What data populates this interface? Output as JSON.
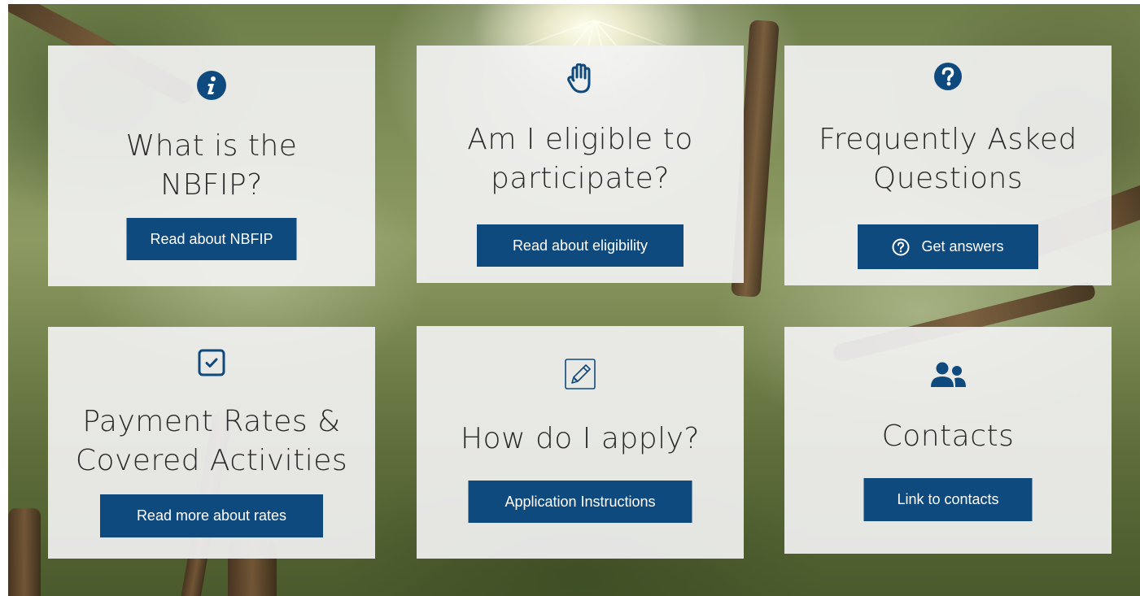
{
  "colors": {
    "accent": "#0f4a7e",
    "card_background": "#f2f2f2",
    "title_text": "#2a2a2a",
    "button_text": "#ffffff"
  },
  "cards": [
    {
      "icon": "info-circle-icon",
      "title_line1": "What is the",
      "title_line2": "NBFIP?",
      "button_label": "Read about NBFIP"
    },
    {
      "icon": "raised-hand-icon",
      "title_line1": "Am I eligible to",
      "title_line2": "participate?",
      "button_label": "Read about eligibility"
    },
    {
      "icon": "question-circle-icon",
      "title_line1": "Frequently Asked",
      "title_line2": "Questions",
      "button_label": "Get answers",
      "button_icon": "question-circle-outline-icon"
    },
    {
      "icon": "checked-box-icon",
      "title_line1": "Payment Rates &",
      "title_line2": "Covered Activities",
      "button_label": "Read more about rates"
    },
    {
      "icon": "pencil-square-icon",
      "title_line1": "How do I apply?",
      "button_label": "Application Instructions"
    },
    {
      "icon": "users-icon",
      "title_line1": "Contacts",
      "button_label": "Link to contacts"
    }
  ]
}
